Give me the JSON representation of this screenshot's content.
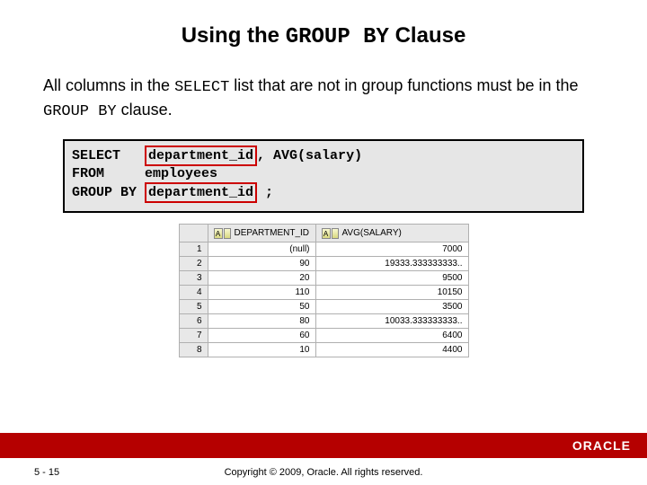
{
  "title": {
    "pre": "Using the ",
    "mono": "GROUP BY",
    "post": " Clause"
  },
  "desc": {
    "t1": "All columns in the ",
    "m1": "SELECT",
    "t2": " list that are not in group functions must be in the ",
    "m2": "GROUP BY",
    "t3": " clause."
  },
  "code": {
    "kw_select": "SELECT   ",
    "hl1": "department_id",
    "after_hl1": ", AVG(salary)",
    "line2": "FROM     employees",
    "kw_groupby": "GROUP BY ",
    "hl2": "department_id",
    "after_hl2": " ;"
  },
  "chart_data": {
    "type": "table",
    "columns": [
      "DEPARTMENT_ID",
      "AVG(SALARY)"
    ],
    "rows": [
      {
        "n": "1",
        "dept": "(null)",
        "avg": "7000"
      },
      {
        "n": "2",
        "dept": "90",
        "avg": "19333.333333333.."
      },
      {
        "n": "3",
        "dept": "20",
        "avg": "9500"
      },
      {
        "n": "4",
        "dept": "110",
        "avg": "10150"
      },
      {
        "n": "5",
        "dept": "50",
        "avg": "3500"
      },
      {
        "n": "6",
        "dept": "80",
        "avg": "10033.333333333.."
      },
      {
        "n": "7",
        "dept": "60",
        "avg": "6400"
      },
      {
        "n": "8",
        "dept": "10",
        "avg": "4400"
      }
    ]
  },
  "logo": "ORACLE",
  "slide_num": "5 - 15",
  "copyright": "Copyright © 2009, Oracle. All rights reserved."
}
